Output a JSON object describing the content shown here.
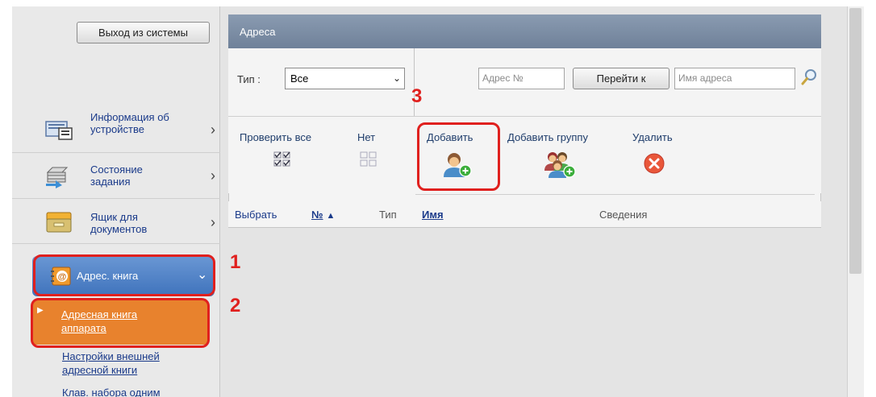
{
  "sidebar": {
    "logout_label": "Выход из системы",
    "items": [
      {
        "label_line1": "Информация об",
        "label_line2": "устройстве"
      },
      {
        "label_line1": "Состояние",
        "label_line2": "задания"
      },
      {
        "label_line1": "Ящик для",
        "label_line2": "документов"
      }
    ],
    "address_book_label": "Адрес. книга",
    "sub_active": {
      "line1": "Адресная книга",
      "line2": "аппарата"
    },
    "sub_links": [
      {
        "line1": "Настройки внешней",
        "line2": "адресной книги"
      },
      {
        "line1": "Клав. набора одним",
        "line2": ""
      }
    ]
  },
  "panel": {
    "title": "Адреса",
    "type_label": "Тип :",
    "type_value": "Все",
    "address_no_placeholder": "Адрес №",
    "goto_label": "Перейти к",
    "address_name_placeholder": "Имя адреса"
  },
  "actions": {
    "check_all": "Проверить все",
    "none": "Нет",
    "add": "Добавить",
    "add_group": "Добавить группу",
    "delete": "Удалить"
  },
  "table": {
    "col_select": "Выбрать",
    "col_no": "№",
    "col_type": "Тип",
    "col_name": "Имя",
    "col_details": "Сведения"
  },
  "steps": {
    "one": "1",
    "two": "2",
    "three": "3"
  },
  "colors": {
    "highlight": "#e0201e",
    "active_orange": "#e8822d",
    "nav_blue": "#3f73bc",
    "header_gray": "#7b8ca3"
  }
}
